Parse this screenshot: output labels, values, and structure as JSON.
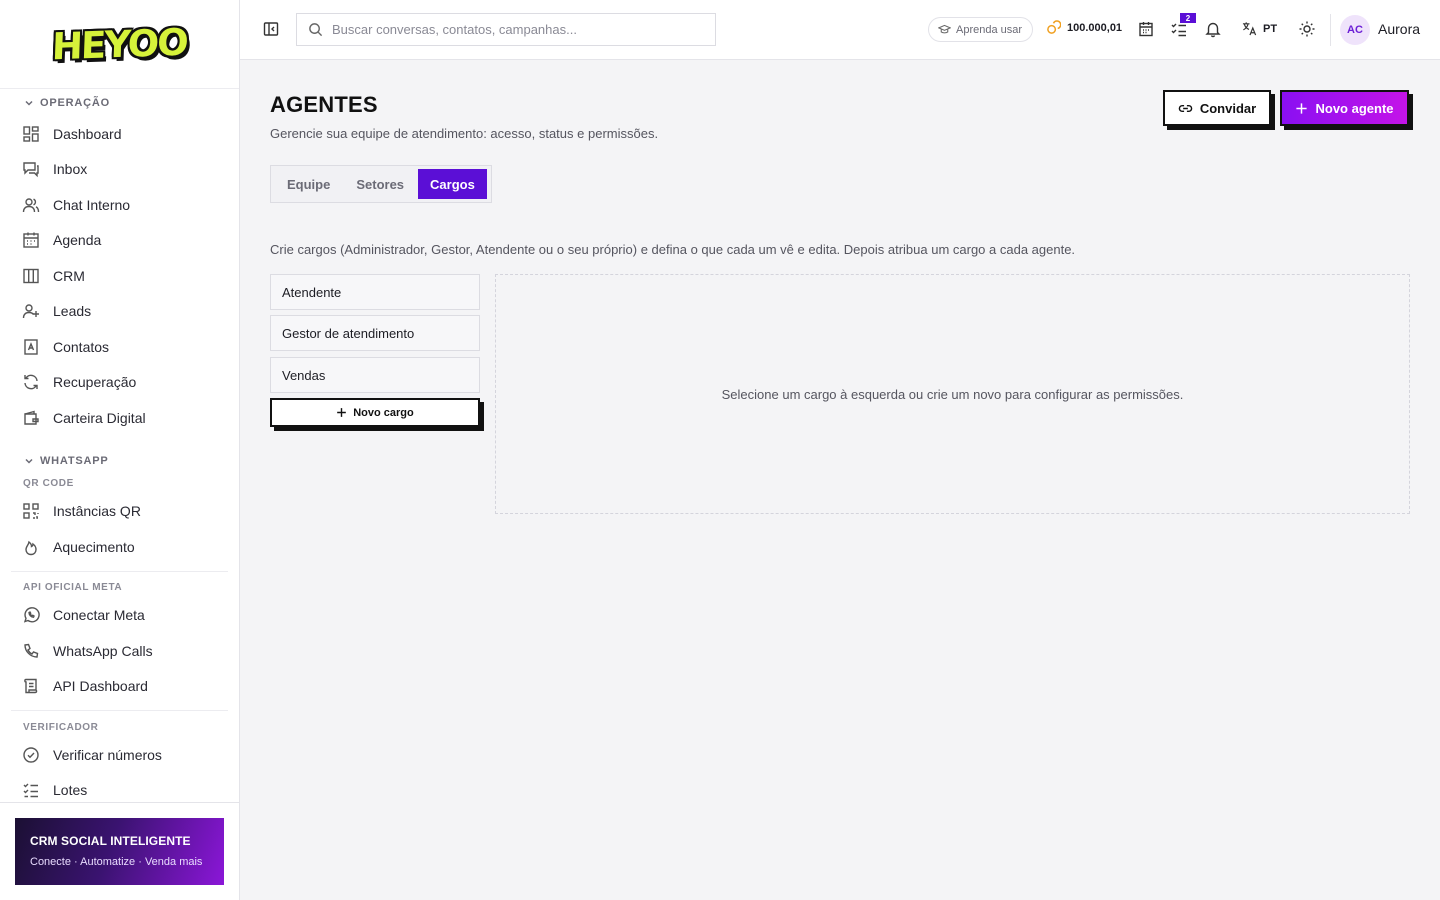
{
  "brand": {
    "logo_text": "HEYOO"
  },
  "search": {
    "placeholder": "Buscar conversas, contatos, campanhas..."
  },
  "header": {
    "learn_label": "Aprenda usar",
    "credits": "100.000,01",
    "tasks_badge": "2",
    "language": "PT",
    "avatar_initials": "AC",
    "user_name": "Aurora"
  },
  "sidebar": {
    "operacao": {
      "title": "OPERAÇÃO",
      "items": [
        {
          "label": "Dashboard",
          "icon": "dashboard-icon"
        },
        {
          "label": "Inbox",
          "icon": "inbox-icon"
        },
        {
          "label": "Chat Interno",
          "icon": "users-icon"
        },
        {
          "label": "Agenda",
          "icon": "calendar-icon"
        },
        {
          "label": "CRM",
          "icon": "kanban-icon"
        },
        {
          "label": "Leads",
          "icon": "user-plus-icon"
        },
        {
          "label": "Contatos",
          "icon": "contact-book-icon"
        },
        {
          "label": "Recuperação",
          "icon": "refresh-icon"
        },
        {
          "label": "Carteira Digital",
          "icon": "wallet-icon"
        }
      ]
    },
    "whatsapp": {
      "title": "WHATSAPP",
      "qr_title": "QR CODE",
      "qr_items": [
        {
          "label": "Instâncias QR",
          "icon": "qr-code-icon"
        },
        {
          "label": "Aquecimento",
          "icon": "flame-icon"
        }
      ],
      "meta_title": "API OFICIAL META",
      "meta_items": [
        {
          "label": "Conectar Meta",
          "icon": "whatsapp-icon"
        },
        {
          "label": "WhatsApp Calls",
          "icon": "phone-icon"
        },
        {
          "label": "API Dashboard",
          "icon": "scroll-icon"
        }
      ],
      "verifier_title": "VERIFICADOR",
      "verifier_items": [
        {
          "label": "Verificar números",
          "icon": "check-circle-icon"
        },
        {
          "label": "Lotes",
          "icon": "list-check-icon"
        }
      ]
    },
    "promo": {
      "title": "CRM SOCIAL INTELIGENTE",
      "subtitle": "Conecte · Automatize · Venda mais"
    }
  },
  "page": {
    "title": "AGENTES",
    "subtitle": "Gerencie sua equipe de atendimento: acesso, status e permissões.",
    "invite_label": "Convidar",
    "new_agent_label": "Novo agente",
    "tabs": [
      {
        "label": "Equipe",
        "active": false
      },
      {
        "label": "Setores",
        "active": false
      },
      {
        "label": "Cargos",
        "active": true
      }
    ],
    "description": "Crie cargos (Administrador, Gestor, Atendente ou o seu próprio) e defina o que cada um vê e edita. Depois atribua um cargo a cada agente.",
    "roles": [
      "Atendente",
      "Gestor de atendimento",
      "Vendas"
    ],
    "new_role_label": "Novo cargo",
    "empty_state": "Selecione um cargo à esquerda ou crie um novo para configurar as permissões."
  },
  "colors": {
    "accent": "#5b0fd6",
    "accent_gradient_end": "#c414e8",
    "logo_yellow": "#d6f23a"
  }
}
